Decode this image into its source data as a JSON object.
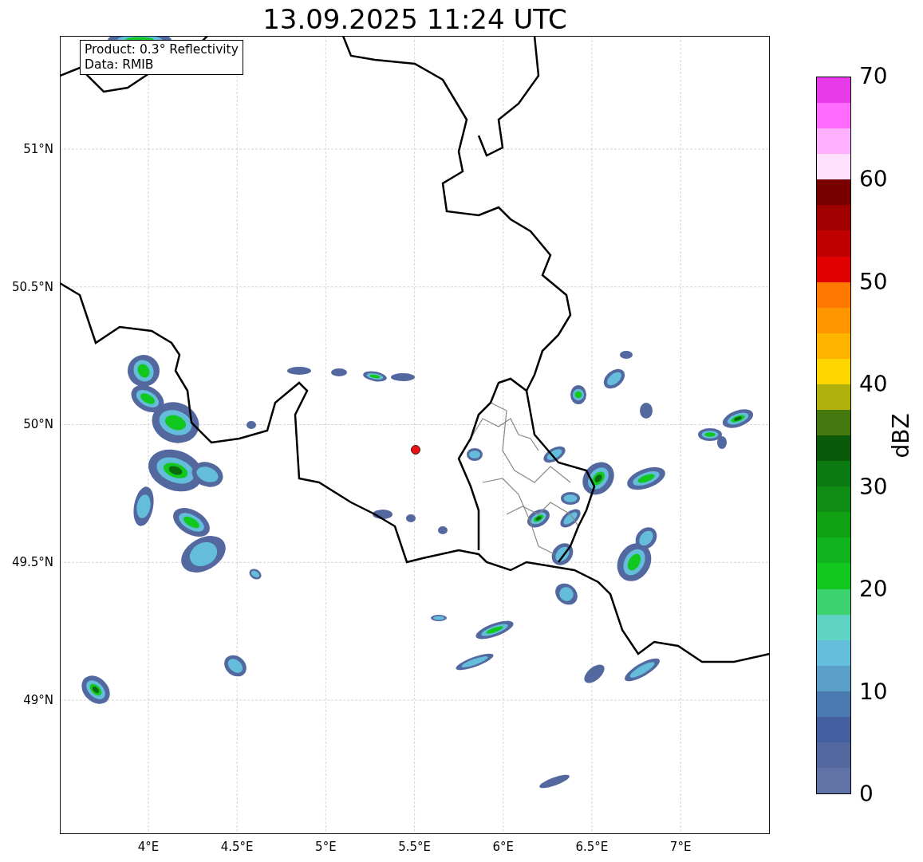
{
  "title": "13.09.2025 11:24 UTC",
  "info_box": {
    "lines": [
      "Product: 0.3° Reflectivity",
      "Data: RMIB"
    ]
  },
  "map": {
    "xticks": [
      "4°E",
      "4.5°E",
      "5°E",
      "5.5°E",
      "6°E",
      "6.5°E",
      "7°E"
    ],
    "yticks": [
      "51°N",
      "50.5°N",
      "50°N",
      "49.5°N",
      "49°N"
    ]
  },
  "colorbar": {
    "label": "dBZ",
    "ticks": [
      "70",
      "60",
      "50",
      "40",
      "30",
      "20",
      "10",
      "0"
    ],
    "bins": [
      {
        "color": "#e83ae8"
      },
      {
        "color": "#ff6cff"
      },
      {
        "color": "#ffb0ff"
      },
      {
        "color": "#ffe0ff"
      },
      {
        "color": "#780000"
      },
      {
        "color": "#a00000"
      },
      {
        "color": "#c00000"
      },
      {
        "color": "#e00000"
      },
      {
        "color": "#ff7800"
      },
      {
        "color": "#ff9600"
      },
      {
        "color": "#ffb400"
      },
      {
        "color": "#ffd700"
      },
      {
        "color": "#b0b00a"
      },
      {
        "color": "#467810"
      },
      {
        "color": "#0a5a0a"
      },
      {
        "color": "#0c7a12"
      },
      {
        "color": "#0e8c14"
      },
      {
        "color": "#0fa014"
      },
      {
        "color": "#10b41e"
      },
      {
        "color": "#12c81e"
      },
      {
        "color": "#3cd26e"
      },
      {
        "color": "#60d4c4"
      },
      {
        "color": "#64bedb"
      },
      {
        "color": "#5a9fc8"
      },
      {
        "color": "#4a7ab0"
      },
      {
        "color": "#4460a0"
      },
      {
        "color": "#5468a0"
      },
      {
        "color": "#6173a6"
      }
    ]
  }
}
